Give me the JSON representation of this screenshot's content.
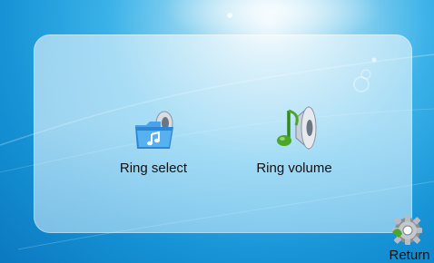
{
  "menu": {
    "items": [
      {
        "label": "Ring select",
        "icon": "folder-music-icon"
      },
      {
        "label": "Ring volume",
        "icon": "speaker-music-icon"
      }
    ]
  },
  "footer": {
    "return_label": "Return",
    "return_icon": "gear-icon"
  },
  "colors": {
    "background": "#1a98da",
    "panel": "#e6f5fc",
    "text": "#111111",
    "icon_blue": "#2b86d6",
    "icon_green": "#4aa72a"
  }
}
